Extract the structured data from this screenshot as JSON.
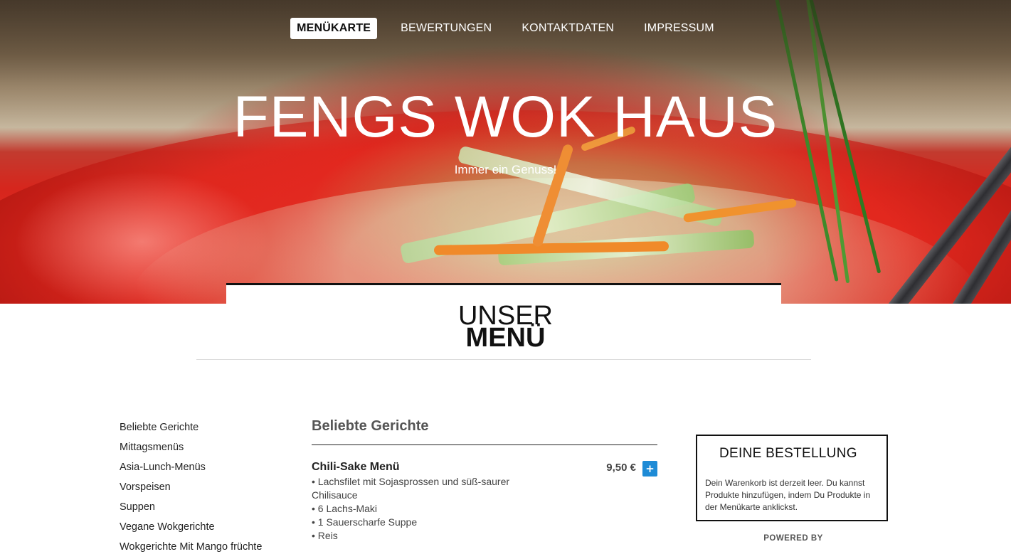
{
  "nav": {
    "items": [
      {
        "label": "MENÜKARTE",
        "active": true
      },
      {
        "label": "BEWERTUNGEN",
        "active": false
      },
      {
        "label": "KONTAKTDATEN",
        "active": false
      },
      {
        "label": "IMPRESSUM",
        "active": false
      }
    ]
  },
  "hero": {
    "title": "FENGS WOK HAUS",
    "subtitle": "Immer ein Genuss!"
  },
  "menu_heading": {
    "line1": "UNSER",
    "line2": "MENÜ"
  },
  "categories": [
    "Beliebte Gerichte",
    "Mittagsmenüs",
    "Asia-Lunch-Menüs",
    "Vorspeisen",
    "Suppen",
    "Vegane Wokgerichte",
    "Wokgerichte Mit Mango früchte"
  ],
  "section": {
    "title": "Beliebte Gerichte"
  },
  "dishes": [
    {
      "name": "Chili-Sake Menü",
      "price": "9,50 €",
      "add_label": "+",
      "desc": [
        "• Lachsfilet mit Sojasprossen und süß-saurer Chilisauce",
        "• 6 Lachs-Maki",
        "• 1 Sauerscharfe Suppe",
        "• Reis"
      ]
    }
  ],
  "order": {
    "title": "DEINE BESTELLUNG",
    "empty_text": "Dein Warenkorb ist derzeit leer. Du kannst Produkte hinzufügen, indem Du Produkte in der Menükarte anklickst.",
    "powered_by": "POWERED BY"
  },
  "colors": {
    "accent": "#1e8bd6",
    "hero_red": "#d9201a"
  }
}
